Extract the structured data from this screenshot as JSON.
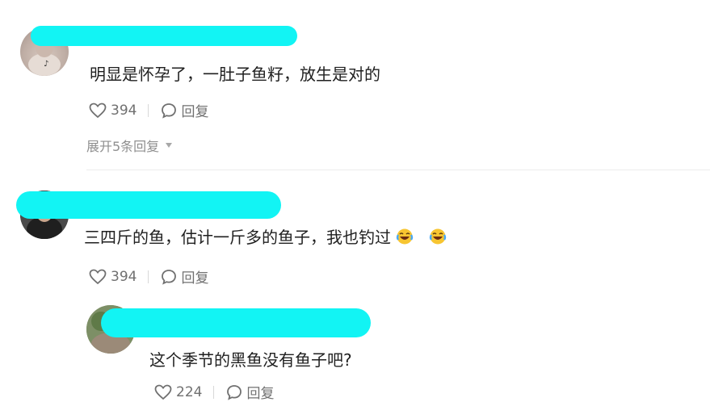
{
  "comments": [
    {
      "text": "明显是怀孕了，一肚子鱼籽，放生是对的",
      "likes": "394",
      "reply_label": "回复",
      "expand_label": "展开5条回复"
    },
    {
      "text": "三四斤的鱼，估计一斤多的鱼子，我也钓过",
      "emojis": [
        "laughing-crying-emoji",
        "laughing-crying-emoji"
      ],
      "likes": "394",
      "reply_label": "回复",
      "replies": [
        {
          "text": "这个季节的黑鱼没有鱼子吧?",
          "likes": "224",
          "reply_label": "回复"
        }
      ]
    }
  ],
  "icons": {
    "like": "heart-outline-icon",
    "reply": "speech-bubble-icon",
    "expand": "caret-down-icon"
  },
  "colors": {
    "redaction": "#12f4f4",
    "meta_text": "#707070"
  }
}
